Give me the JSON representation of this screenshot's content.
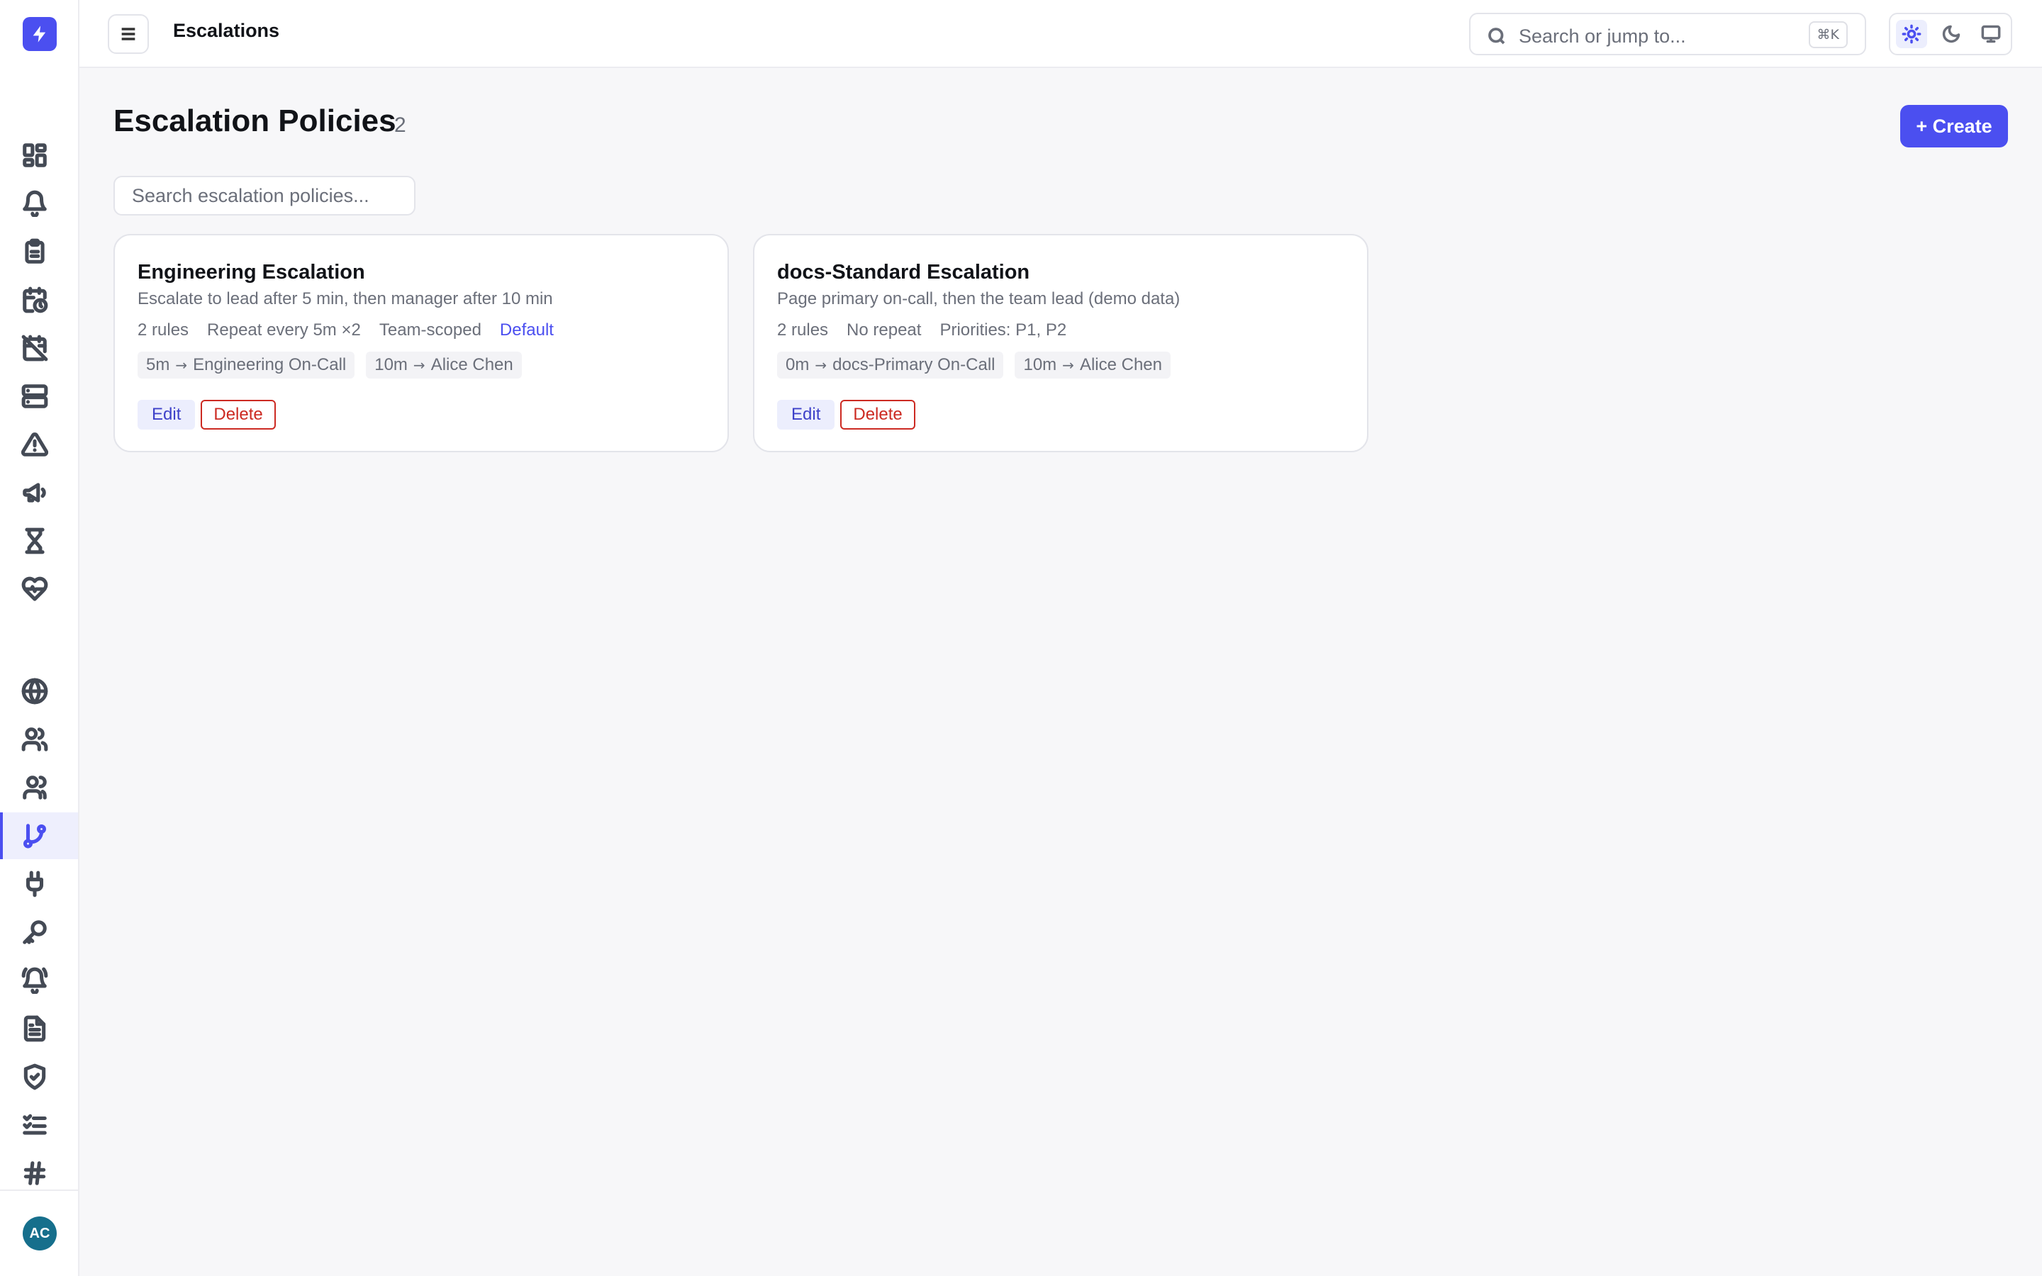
{
  "app": {
    "logo_icon": "lightning-bolt-icon",
    "accent_color": "#4b4ff0"
  },
  "header": {
    "title": "Escalations",
    "search_placeholder": "Search or jump to...",
    "search_shortcut": "⌘K",
    "theme_options": [
      "light-icon",
      "dark-icon",
      "system-icon"
    ],
    "active_theme": "light"
  },
  "sidebar": {
    "items": [
      {
        "icon": "dashboard-icon"
      },
      {
        "icon": "bell-icon"
      },
      {
        "icon": "clipboard-icon"
      },
      {
        "icon": "calendar-clock-icon"
      },
      {
        "icon": "calendar-off-icon"
      },
      {
        "icon": "server-icon"
      },
      {
        "icon": "alert-triangle-icon"
      },
      {
        "icon": "megaphone-icon"
      },
      {
        "icon": "hourglass-icon"
      },
      {
        "icon": "heart-pulse-icon"
      },
      {
        "icon": "globe-icon"
      },
      {
        "icon": "users-icon"
      },
      {
        "icon": "team-icon"
      },
      {
        "icon": "git-branch-icon",
        "active": true
      },
      {
        "icon": "plug-icon"
      },
      {
        "icon": "key-icon"
      },
      {
        "icon": "bell-ring-icon"
      },
      {
        "icon": "document-icon"
      },
      {
        "icon": "shield-check-icon"
      },
      {
        "icon": "checklist-icon"
      },
      {
        "icon": "hash-icon"
      }
    ],
    "avatar_initials": "AC"
  },
  "main": {
    "title": "Escalation Policies",
    "count": "2",
    "create_label": "+ Create",
    "search_placeholder": "Search escalation policies..."
  },
  "policies": [
    {
      "name": "Engineering Escalation",
      "description": "Escalate to lead after 5 min, then manager after 10 min",
      "rules": "2 rules",
      "repeat": "Repeat every 5m ×2",
      "scope": "Team-scoped",
      "badge": "Default",
      "steps": [
        {
          "delay": "5m",
          "target": "Engineering On-Call"
        },
        {
          "delay": "10m",
          "target": "Alice Chen"
        }
      ],
      "edit_label": "Edit",
      "delete_label": "Delete"
    },
    {
      "name": "docs-Standard Escalation",
      "description": "Page primary on-call, then the team lead (demo data)",
      "rules": "2 rules",
      "repeat": "No repeat",
      "scope": "Priorities: P1, P2",
      "steps": [
        {
          "delay": "0m",
          "target": "docs-Primary On-Call"
        },
        {
          "delay": "10m",
          "target": "Alice Chen"
        }
      ],
      "edit_label": "Edit",
      "delete_label": "Delete"
    }
  ]
}
